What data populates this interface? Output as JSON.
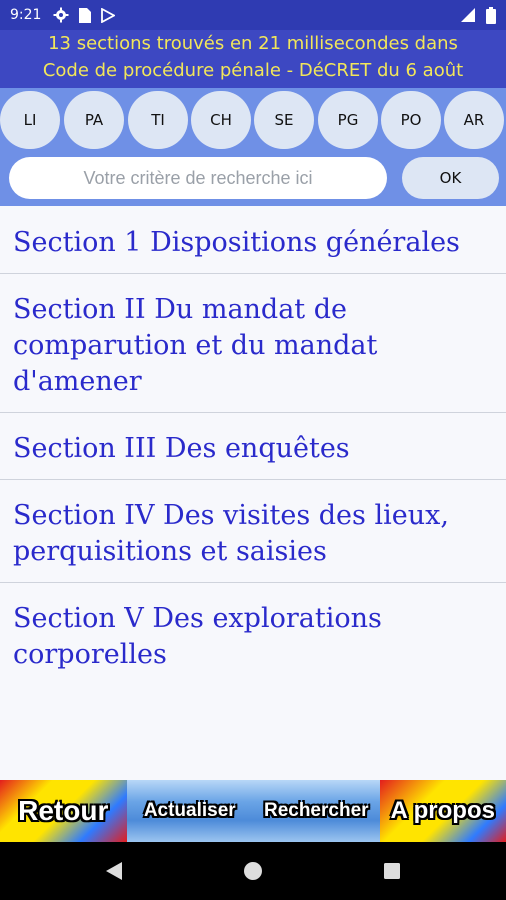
{
  "status_bar": {
    "time": "9:21"
  },
  "header": {
    "line1": "13 sections trouvés  en 21 millisecondes dans",
    "line2": "Code de procédure pénale - DéCRET du 6 août"
  },
  "filters": [
    "LI",
    "PA",
    "TI",
    "CH",
    "SE",
    "PG",
    "PO",
    "AR"
  ],
  "search": {
    "placeholder": "Votre critère de recherche ici",
    "value": ""
  },
  "ok_label": "OK",
  "results": [
    "Section 1 Dispositions générales",
    "Section II Du mandat de comparution et du mandat d'amener",
    "Section III Des enquêtes",
    "Section IV Des visites des lieux, perquisitions et saisies",
    "Section V Des explorations corporelles"
  ],
  "bottom_nav": {
    "back_label": "Retour",
    "refresh_label": "Actualiser",
    "search_label": "Rechercher",
    "about_label": "A propos"
  }
}
